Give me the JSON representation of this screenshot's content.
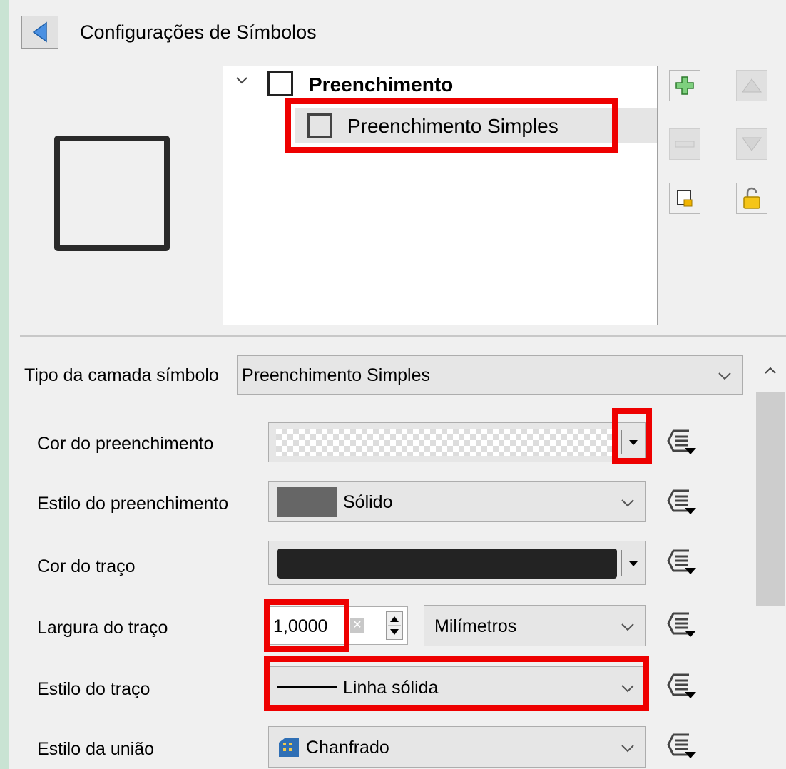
{
  "header": {
    "title": "Configurações de Símbolos"
  },
  "tree": {
    "parent_label": "Preenchimento",
    "child_label": "Preenchimento Simples"
  },
  "side_buttons": [
    "add-layer",
    "move-up",
    "remove-layer",
    "move-down",
    "duplicate-layer",
    "lock-layer"
  ],
  "layer_type": {
    "label": "Tipo da camada símbolo",
    "value": "Preenchimento Simples"
  },
  "properties": {
    "fill_color": {
      "label": "Cor do preenchimento",
      "value_color": "transparent"
    },
    "fill_style": {
      "label": "Estilo do preenchimento",
      "value": "Sólido",
      "swatch_color": "#666666"
    },
    "stroke_color": {
      "label": "Cor do traço",
      "value_color": "#232323"
    },
    "stroke_width": {
      "label": "Largura do traço",
      "value": "1,0000",
      "unit": "Milímetros"
    },
    "stroke_style": {
      "label": "Estilo do traço",
      "value": "Linha sólida"
    },
    "join_style": {
      "label": "Estilo da união",
      "value": "Chanfrado"
    }
  },
  "highlight_color": "#ee0000"
}
